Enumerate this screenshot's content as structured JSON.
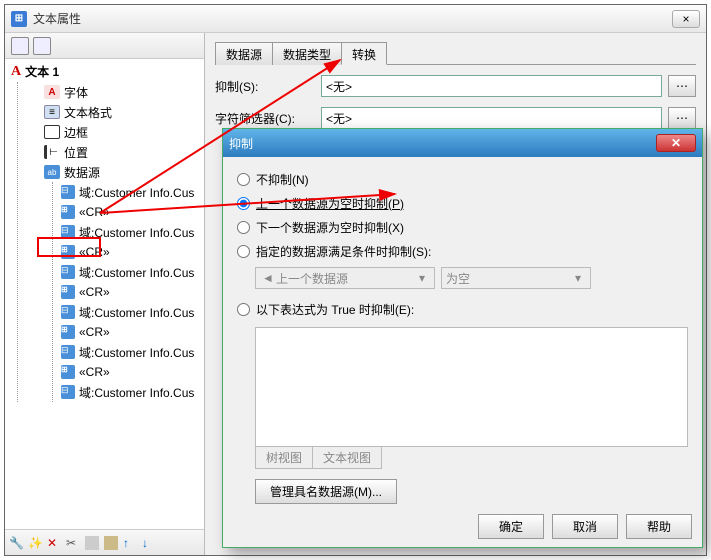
{
  "window": {
    "title": "文本属性",
    "close": "×"
  },
  "tree": {
    "root": "文本 1",
    "font": "字体",
    "format": "文本格式",
    "border": "边框",
    "position": "位置",
    "datasource": "数据源",
    "field": "域:Customer Info.Cus",
    "cr": "«CR»"
  },
  "tabs": {
    "t1": "数据源",
    "t2": "数据类型",
    "t3": "转换"
  },
  "form": {
    "suppress_label": "抑制(S):",
    "suppress_value": "<无>",
    "filter_label": "字符筛选器(C):",
    "filter_value": "<无>"
  },
  "dialog": {
    "title": "抑制",
    "close": "✕",
    "r1": "不抑制(N)",
    "r2": "上一个数据源为空时抑制(P)",
    "r3": "下一个数据源为空时抑制(X)",
    "r4": "指定的数据源满足条件时抑制(S):",
    "combo1": "上一个数据源",
    "combo2": "为空",
    "r5": "以下表达式为 True 时抑制(E):",
    "subtab1": "树视图",
    "subtab2": "文本视图",
    "manage": "管理具名数据源(M)...",
    "ok": "确定",
    "cancel": "取消",
    "help": "帮助"
  }
}
